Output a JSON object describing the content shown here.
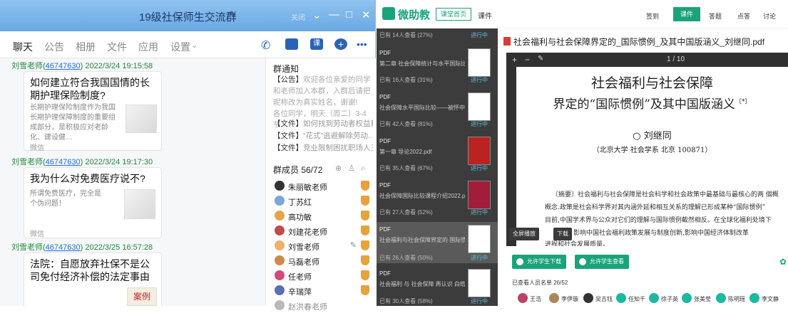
{
  "qq": {
    "group_title": "19级社保师生交流群",
    "title_extra": "关闭",
    "tabs": [
      "聊天",
      "公告",
      "相册",
      "文件",
      "应用",
      "设置"
    ],
    "messages": [
      {
        "sender": "刘雪老师",
        "qq_id": "46747630",
        "time": "2022/3/24 19:15:58",
        "title": "如何建立符合我国国情的长期护理保险制度?",
        "desc": "长期护理保险制度作为我国长期护理保障制度的重要组成部分，是积极应对老龄化、建设健…",
        "source": "微信"
      },
      {
        "sender": "刘雪老师",
        "qq_id": "46747630",
        "time": "2022/3/24 19:17:30",
        "title": "我为什么对免费医疗说不?",
        "desc": "所谓免费医疗，完全是个伪问题！",
        "source": "微信"
      },
      {
        "sender": "刘雪老师",
        "qq_id": "46747630",
        "time": "2022/3/25 16:57:28",
        "title": "法院：自愿放弃社保不是公司免付经济补偿的法定事由",
        "thumb_label": "案例"
      }
    ],
    "notice_title": "群通知",
    "notice_items": [
      {
        "tag": "【公告】",
        "text": "欢迎各位亲爱的同学和老师加入本群，入群后请把昵称改为真实姓名，谢谢!"
      },
      {
        "tag": "",
        "text": "各位同学，明天（周二）3-4节…"
      }
    ],
    "file_items": [
      {
        "tag": "【文件】",
        "text": "如何找到劳动者权益和…"
      },
      {
        "tag": "【文件】",
        "text": "“花式”逃避解除劳动…"
      },
      {
        "tag": "【文件】",
        "text": "竞业限制困扰职场人三…"
      }
    ],
    "members_label": "群成员 56/72",
    "members": [
      "朱丽敏老师",
      "丁苏红",
      "高功敏",
      "刘建花老师",
      "刘雪老师",
      "马磊老师",
      "任老师",
      "辛瑞萍",
      "赵洪春老师"
    ]
  },
  "mid": {
    "app_name": "微助教",
    "home_btn": "课堂首页",
    "course": "课件",
    "items": [
      {
        "head": "已有 14人查看 (27%)",
        "status": "进行中",
        "type": "",
        "name": ""
      },
      {
        "head": "已有 16人查看 (31%)",
        "status": "进行中",
        "type": "PDF",
        "name": "第二章 社会保障统计与水平国际比较.pdf"
      },
      {
        "head": "已有 42人查看 (81%)",
        "status": "进行中",
        "type": "PDF",
        "name": "社会保障水平国际比较——被怀中.pdf"
      },
      {
        "head": "已有 35人查看 (67%)",
        "status": "进行中",
        "type": "PDF",
        "name": "第一章 导论2022.pdf"
      },
      {
        "head": "已有 27人查看 (52%)",
        "status": "进行中",
        "type": "PDF",
        "name": "社会保障国际比较课程介绍2022.pdf"
      },
      {
        "head": "已有 26人查看 (50%)",
        "status": "进行中",
        "type": "PDF",
        "name": "社会福利与社会保障界定的 国际惯例 及其中…"
      },
      {
        "head": "已有 30人查看 (58%)",
        "status": "进行中",
        "type": "PDF",
        "name": "社会福利 与 社会保障 再认识 白皓琰.pdf"
      }
    ]
  },
  "right": {
    "toolbar": [
      "签到",
      "课件",
      "答题",
      "点答",
      "讨论"
    ],
    "doc_title": "社会福利与社会保障界定的_国际惯例_及其中国版涵义_刘继同.pdf",
    "page_indicator": "1 / 10",
    "paper_title_1": "社会福利与社会保障",
    "paper_title_2": "界定的“国际惯例”及其中国版涵义",
    "paper_mark": "〔*〕",
    "author": "○ 刘继同",
    "affiliation": "（北京大学 社会学系  北京 100871）",
    "abstract_lines": [
      "〔摘要〕社会福利与社会保障是社会科学和社会政策中最基础与最核心的两  個概",
      "概念.政策是社会科学界对其内涵外延和相互关系的理解已形成某种“国际惯例”",
      "目前,中国学术界与公众对它们的理解与国际惯例截然相反。在全球化福利处境下",
      "影响中国社会福利政策发展与制度创新,影响中国经济体制改革",
      "进程和社会发展质量。"
    ],
    "fullscreen": "全屏播放",
    "download": "下载",
    "allow_download": "允许学生下载",
    "allow_view": "允许学生查看",
    "viewed_label": "已查看人员名单  26/52",
    "viewers": [
      "王浩",
      "李伊璇",
      "吴吉钰",
      "任知千",
      "徐子英",
      "张美莹",
      "陈明瑶",
      "李文静"
    ]
  },
  "colors": {
    "qq_title": "#79b5ea",
    "accent_blue": "#1e6fd9",
    "green": "#1aa37a",
    "mid_bg": "#3c3c3c"
  }
}
